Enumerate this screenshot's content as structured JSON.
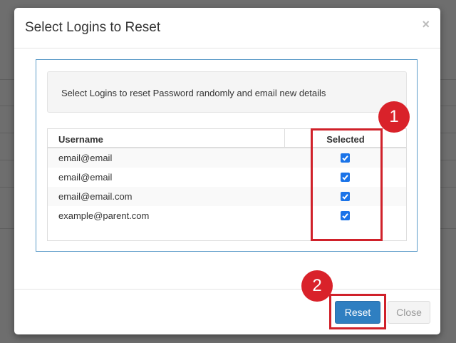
{
  "modal": {
    "title": "Select Logins to Reset",
    "close_glyph": "×"
  },
  "info": {
    "text": "Select Logins to reset Password randomly and email new details"
  },
  "table": {
    "columns": [
      "Username",
      "Selected"
    ],
    "rows": [
      {
        "username": "email@email",
        "selected": true
      },
      {
        "username": "email@email",
        "selected": true
      },
      {
        "username": "email@email.com",
        "selected": true
      },
      {
        "username": "example@parent.com",
        "selected": true
      }
    ]
  },
  "annotations": {
    "badge_1": "1",
    "badge_2": "2",
    "color": "#d9222a"
  },
  "footer": {
    "reset_label": "Reset",
    "close_label": "Close"
  },
  "colors": {
    "primary": "#2f7fc1",
    "checkbox": "#1a73e8"
  }
}
